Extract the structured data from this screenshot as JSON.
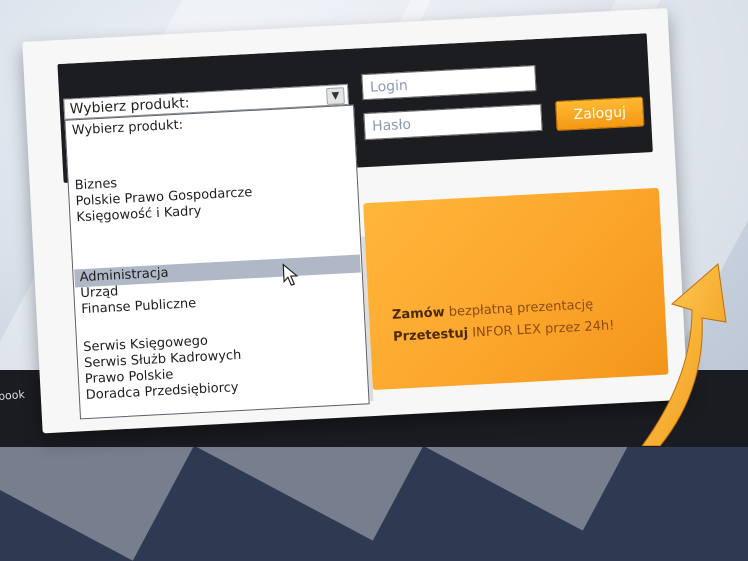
{
  "login_form": {
    "product_select": {
      "value": "Wybierz produkt:"
    },
    "login_placeholder": "Login",
    "password_placeholder": "Hasło",
    "submit_label": "Zaloguj"
  },
  "dropdown": {
    "items": [
      "Wybierz produkt:",
      "Biznes",
      "Polskie Prawo Gospodarcze",
      "Księgowość i Kadry",
      "Administracja",
      "Urząd",
      "Finanse Publiczne",
      "Serwis Księgowego",
      "Serwis Służb Kadrowych",
      "Prawo Polskie",
      "Doradca Przedsiębiorcy"
    ],
    "highlighted": "Administracja"
  },
  "promo": {
    "line1_bold": "Zamów",
    "line1_rest": "bezpłatną prezentację",
    "line2_bold": "Przetestuj",
    "line2_rest": "INFOR LEX przez 24h!"
  },
  "background": {
    "partial_text": "book"
  },
  "colors": {
    "accent": "#f7a21f",
    "dark_bar": "#1b1d21",
    "highlight": "#b0b7c6"
  }
}
